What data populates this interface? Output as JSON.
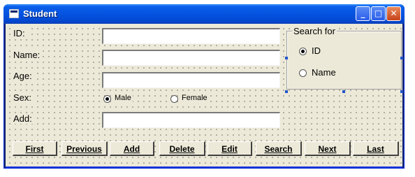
{
  "window": {
    "title": "Student"
  },
  "form": {
    "id_label": "ID:",
    "name_label": "Name:",
    "age_label": "Age:",
    "sex_label": "Sex:",
    "add_label": "Add:",
    "id_value": "",
    "name_value": "",
    "age_value": "",
    "add_value": "",
    "sex_options": [
      {
        "label": "Male",
        "checked": true
      },
      {
        "label": "Female",
        "checked": false
      }
    ]
  },
  "search_frame": {
    "title": "Search for",
    "options": [
      {
        "label": "ID",
        "checked": true
      },
      {
        "label": "Name",
        "checked": false
      }
    ]
  },
  "buttons": [
    "First",
    "Previous",
    "Add",
    "Delete",
    "Edit",
    "Search",
    "Next",
    "Last"
  ],
  "colors": {
    "titlebar": "#0553e1",
    "client": "#ece9d8",
    "selection_handle": "#2255cc"
  }
}
